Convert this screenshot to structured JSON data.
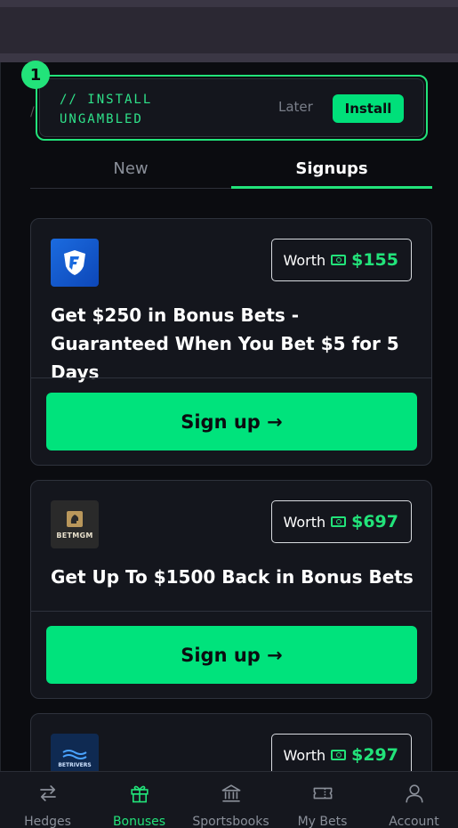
{
  "install_banner": {
    "badge": "1",
    "text": "// INSTALL UNGAMBLED",
    "later_label": "Later",
    "install_label": "Install"
  },
  "tabs": [
    {
      "label": "New",
      "active": false
    },
    {
      "label": "Signups",
      "active": true
    }
  ],
  "offers": [
    {
      "sportsbook": "FanDuel",
      "worth_label": "Worth",
      "worth_value": "$155",
      "title": "Get $250 in Bonus Bets - Guaranteed When You Bet $5 for 5 Days",
      "cta": "Sign up →"
    },
    {
      "sportsbook": "BetMGM",
      "logo_text": "BETMGM",
      "worth_label": "Worth",
      "worth_value": "$697",
      "title": "Get Up To $1500 Back in Bonus Bets",
      "cta": "Sign up →"
    },
    {
      "sportsbook": "BetRivers",
      "logo_text": "BETRIVERS",
      "worth_label": "Worth",
      "worth_value": "$297"
    }
  ],
  "bottom_nav": [
    {
      "label": "Hedges",
      "icon": "arrows-swap-icon",
      "active": false
    },
    {
      "label": "Bonuses",
      "icon": "gift-icon",
      "active": true
    },
    {
      "label": "Sportsbooks",
      "icon": "bank-icon",
      "active": false
    },
    {
      "label": "My Bets",
      "icon": "ticket-icon",
      "active": false
    },
    {
      "label": "Account",
      "icon": "user-icon",
      "active": false
    }
  ],
  "colors": {
    "accent": "#22e37a",
    "button": "#00e37c",
    "card_bg": "#14161d",
    "page_bg": "#0b0c10"
  }
}
